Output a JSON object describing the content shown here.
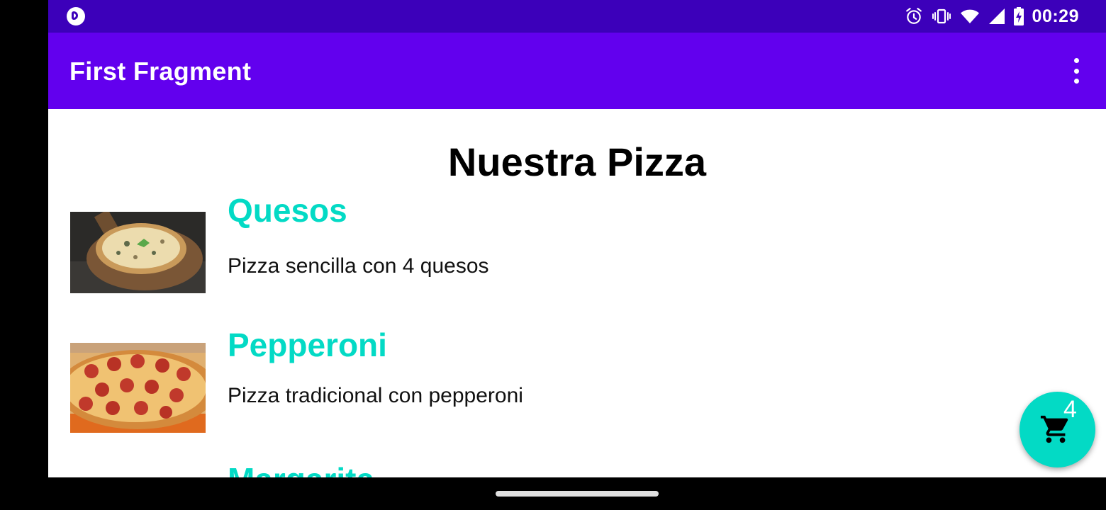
{
  "status_bar": {
    "time": "00:29",
    "icons": [
      "app-notification-icon",
      "alarm-icon",
      "vibrate-icon",
      "wifi-icon",
      "signal-icon",
      "battery-charging-icon"
    ]
  },
  "app_bar": {
    "title": "First Fragment",
    "overflow_icon": "more-vert-icon"
  },
  "content": {
    "heading": "Nuestra Pizza",
    "items": [
      {
        "name": "Quesos",
        "description": "Pizza sencilla con 4 quesos",
        "image": "four-cheese-pizza"
      },
      {
        "name": "Pepperoni",
        "description": "Pizza tradicional con pepperoni",
        "image": "pepperoni-pizza"
      },
      {
        "name": "Margarita",
        "description": ""
      }
    ]
  },
  "fab": {
    "icon": "shopping-cart-icon",
    "badge": "4"
  },
  "colors": {
    "status_bar": "#3C00BA",
    "app_bar": "#6200EE",
    "accent": "#03DAC5"
  }
}
